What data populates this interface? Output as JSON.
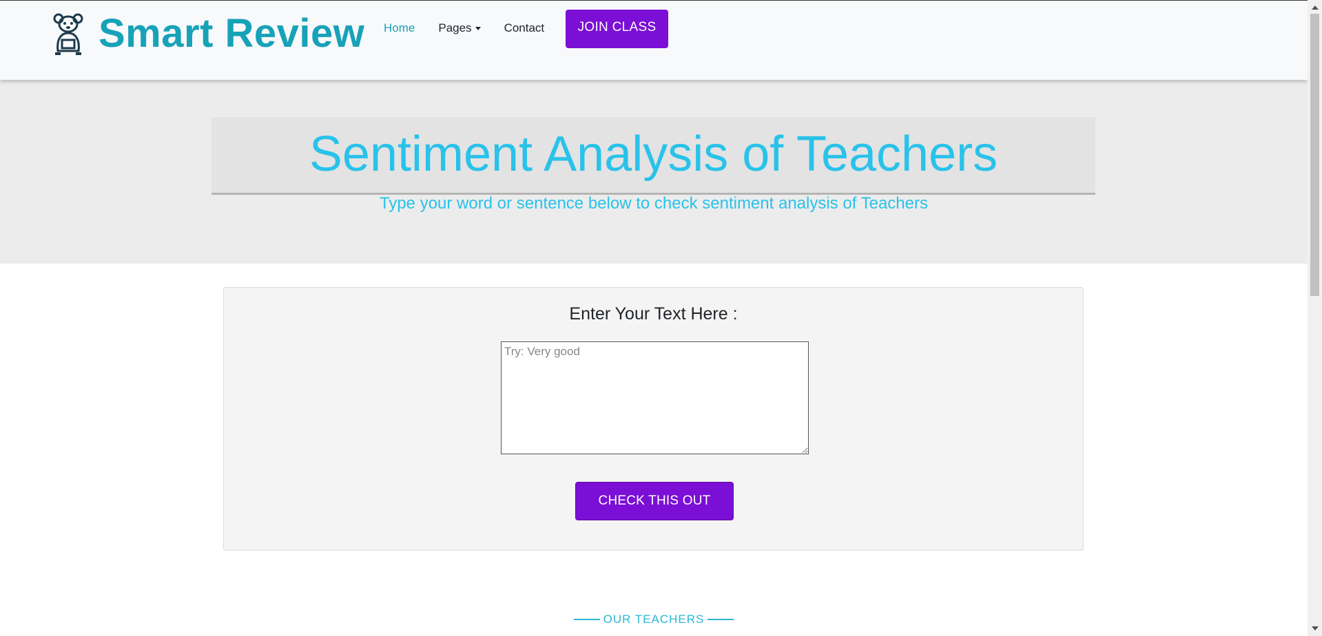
{
  "colors": {
    "brand": "#17a2b8",
    "accent_purple": "#7b0fd6",
    "hero_text": "#29c2ea",
    "hero_bg": "#ececec"
  },
  "navbar": {
    "brand_icon": "teddy-bear-icon",
    "brand_name": "Smart Review",
    "links": [
      {
        "label": "Home",
        "active": true
      },
      {
        "label": "Pages",
        "dropdown": true
      },
      {
        "label": "Contact"
      }
    ],
    "cta_label": "JOIN CLASS"
  },
  "hero": {
    "title": "Sentiment Analysis of Teachers",
    "subtitle": "Type your word or sentence below to check sentiment analysis of Teachers"
  },
  "form": {
    "label": "Enter Your Text Here :",
    "placeholder": "Try: Very good",
    "value": "",
    "submit_label": "CHECK THIS OUT"
  },
  "section": {
    "heading": "OUR TEACHERS"
  }
}
